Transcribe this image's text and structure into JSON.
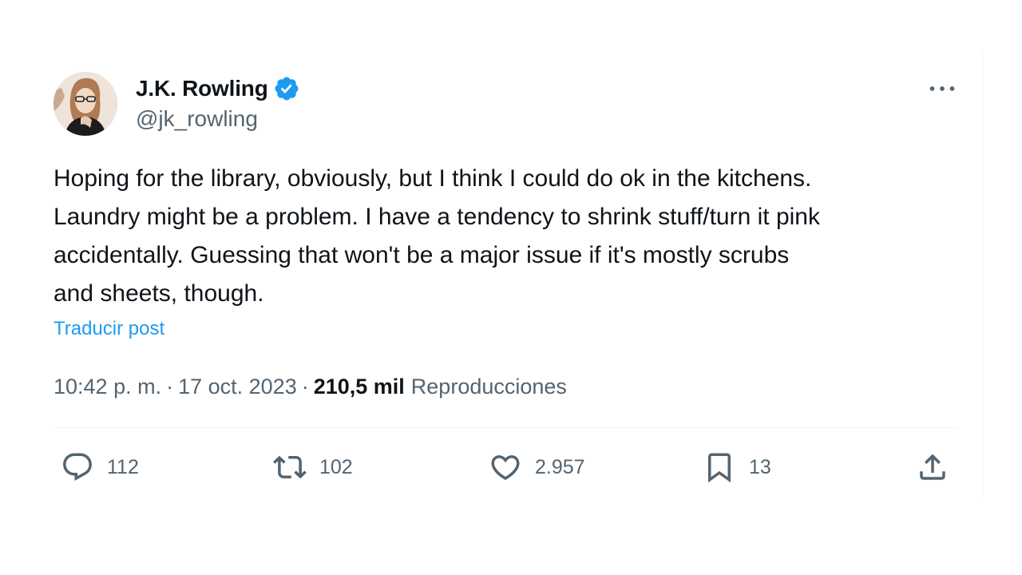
{
  "author": {
    "display_name": "J.K. Rowling",
    "handle": "@jk_rowling",
    "verified": true
  },
  "tweet": {
    "lines": [
      "Hoping for the library, obviously, but I think I could do ok in the kitchens.",
      "Laundry might be a problem. I have a tendency to shrink stuff/turn it pink",
      "accidentally. Guessing that won't be a major issue if it's mostly scrubs",
      "and sheets, though."
    ],
    "translate_label": "Traducir post"
  },
  "meta": {
    "time": "10:42 p. m.",
    "separator": "·",
    "date": "17 oct. 2023",
    "views_count": "210,5 mil",
    "views_label": "Reproducciones"
  },
  "actions": {
    "replies": "112",
    "reposts": "102",
    "likes": "2.957",
    "bookmarks": "13"
  },
  "icons": {
    "verified": "verified-badge-icon",
    "more": "more-dots-icon",
    "reply": "reply-icon",
    "repost": "repost-icon",
    "like": "heart-icon",
    "bookmark": "bookmark-icon",
    "share": "share-icon"
  },
  "colors": {
    "accent": "#1d9bf0",
    "text_primary": "#0f1419",
    "text_secondary": "#536471",
    "divider": "#eff3f4"
  }
}
